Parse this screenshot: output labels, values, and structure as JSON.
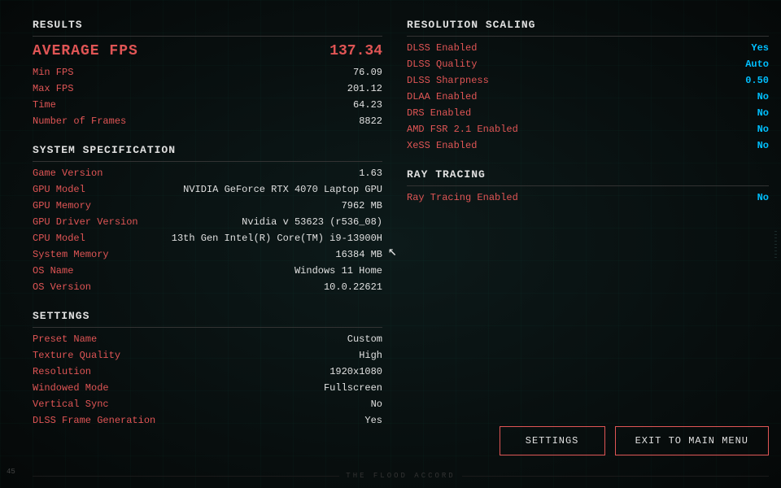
{
  "left": {
    "results": {
      "title": "Results",
      "average_fps_label": "Average FPS",
      "average_fps_value": "137.34",
      "rows": [
        {
          "label": "Min FPS",
          "value": "76.09"
        },
        {
          "label": "Max FPS",
          "value": "201.12"
        },
        {
          "label": "Time",
          "value": "64.23"
        },
        {
          "label": "Number of Frames",
          "value": "8822"
        }
      ]
    },
    "system": {
      "title": "System Specification",
      "rows": [
        {
          "label": "Game Version",
          "value": "1.63"
        },
        {
          "label": "GPU Model",
          "value": "NVIDIA GeForce RTX 4070 Laptop GPU"
        },
        {
          "label": "GPU Memory",
          "value": "7962 MB"
        },
        {
          "label": "GPU Driver Version",
          "value": "Nvidia v 53623 (r536_08)"
        },
        {
          "label": "CPU Model",
          "value": "13th Gen Intel(R) Core(TM) i9-13900H"
        },
        {
          "label": "System Memory",
          "value": "16384 MB"
        },
        {
          "label": "OS Name",
          "value": "Windows 11 Home"
        },
        {
          "label": "OS Version",
          "value": "10.0.22621"
        }
      ]
    },
    "settings": {
      "title": "Settings",
      "rows": [
        {
          "label": "Preset Name",
          "value": "Custom"
        },
        {
          "label": "Texture Quality",
          "value": "High"
        },
        {
          "label": "Resolution",
          "value": "1920x1080"
        },
        {
          "label": "Windowed Mode",
          "value": "Fullscreen"
        },
        {
          "label": "Vertical Sync",
          "value": "No"
        },
        {
          "label": "DLSS Frame Generation",
          "value": "Yes"
        }
      ]
    }
  },
  "right": {
    "resolution_scaling": {
      "title": "Resolution Scaling",
      "rows": [
        {
          "label": "DLSS Enabled",
          "value": "Yes"
        },
        {
          "label": "DLSS Quality",
          "value": "Auto"
        },
        {
          "label": "DLSS Sharpness",
          "value": "0.50"
        },
        {
          "label": "DLAA Enabled",
          "value": "No"
        },
        {
          "label": "DRS Enabled",
          "value": "No"
        },
        {
          "label": "AMD FSR 2.1 Enabled",
          "value": "No"
        },
        {
          "label": "XeSS Enabled",
          "value": "No"
        }
      ]
    },
    "ray_tracing": {
      "title": "Ray Tracing",
      "rows": [
        {
          "label": "Ray Tracing Enabled",
          "value": "No"
        }
      ]
    }
  },
  "buttons": {
    "settings_label": "Settings",
    "exit_label": "Exit to Main Menu"
  },
  "bottom_text": "THE FLOOD ACCORD",
  "corner_text": "45"
}
